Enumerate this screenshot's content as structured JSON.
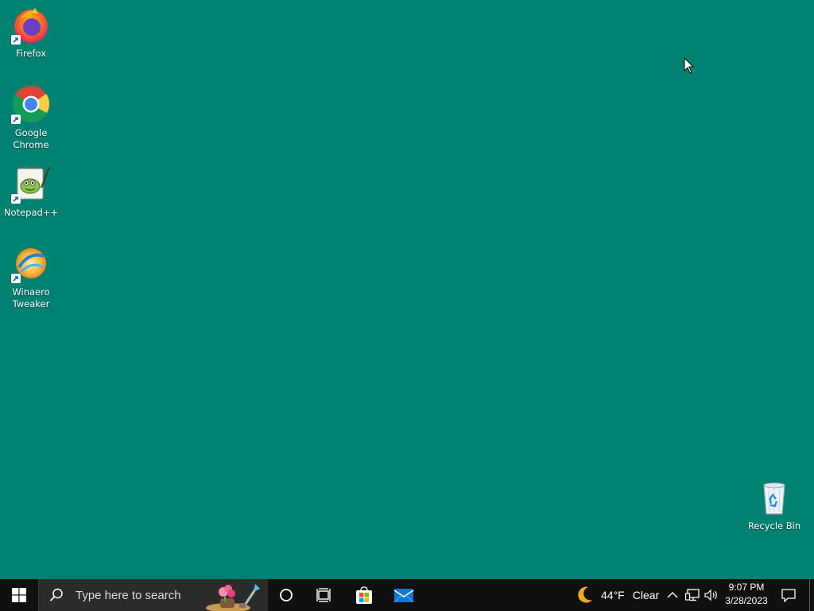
{
  "desktop": {
    "background_color": "#008272",
    "icons": [
      {
        "label": "Firefox",
        "icon": "firefox-icon",
        "shortcut": true
      },
      {
        "label": "Google Chrome",
        "icon": "chrome-icon",
        "shortcut": true
      },
      {
        "label": "Notepad++",
        "icon": "notepad-plus-plus-icon",
        "shortcut": true
      },
      {
        "label": "Winaero Tweaker",
        "icon": "winaero-tweaker-icon",
        "shortcut": true
      },
      {
        "label": "Recycle Bin",
        "icon": "recycle-bin-icon",
        "shortcut": false
      }
    ]
  },
  "taskbar": {
    "background_color": "#101010",
    "start_icon": "windows-logo-icon",
    "search": {
      "placeholder": "Type here to search",
      "icon": "search-icon"
    },
    "pinned": [
      {
        "icon": "cortana-icon"
      },
      {
        "icon": "task-view-icon"
      },
      {
        "icon": "microsoft-store-icon"
      },
      {
        "icon": "mail-icon"
      }
    ],
    "weather": {
      "temperature": "44°F",
      "condition": "Clear",
      "icon": "moon-icon"
    },
    "tray": {
      "chevron_icon": "chevron-up-icon",
      "network_icon": "network-icon",
      "volume_icon": "volume-icon"
    },
    "clock": {
      "time": "9:07 PM",
      "date": "3/28/2023"
    },
    "notifications_icon": "action-center-icon"
  }
}
